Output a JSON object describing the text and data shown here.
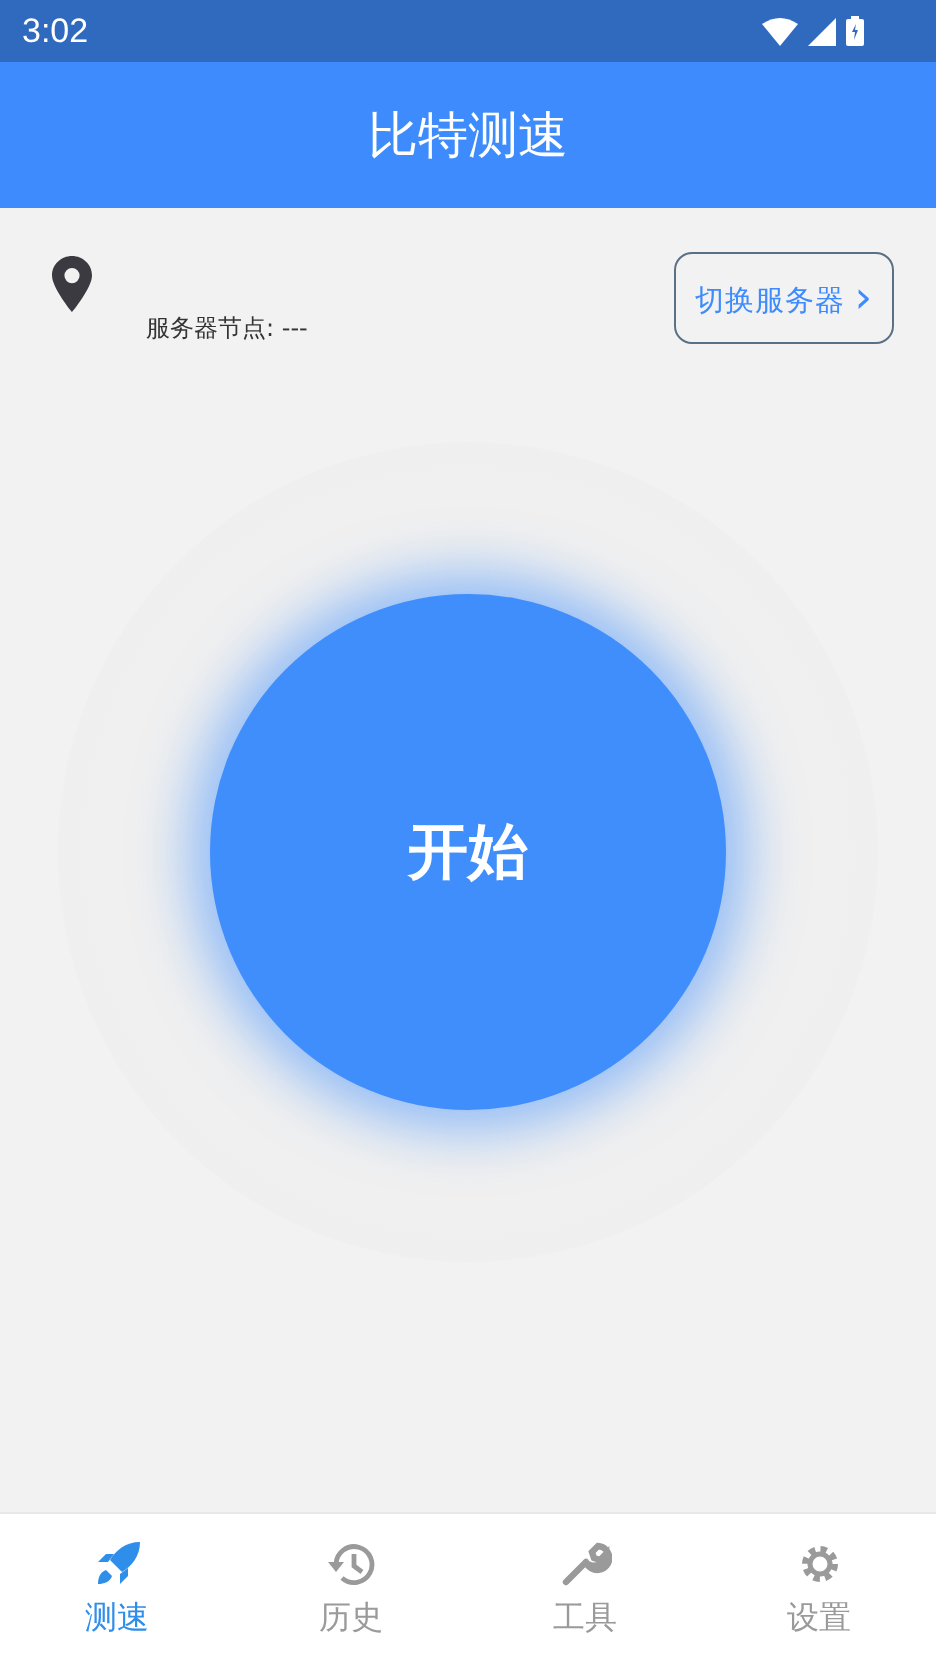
{
  "status_bar": {
    "time": "3:02"
  },
  "header": {
    "title": "比特测速"
  },
  "server": {
    "node_label": "服务器节点: ---",
    "switch_button": "切换服务器",
    "chevron": "›"
  },
  "start_button": {
    "label": "开始"
  },
  "tabs": [
    {
      "kind": "rocket",
      "label": "测速",
      "selected": true
    },
    {
      "kind": "history",
      "label": "历史",
      "selected": false
    },
    {
      "kind": "wrench",
      "label": "工具",
      "selected": false
    },
    {
      "kind": "gear",
      "label": "设置",
      "selected": false
    }
  ]
}
